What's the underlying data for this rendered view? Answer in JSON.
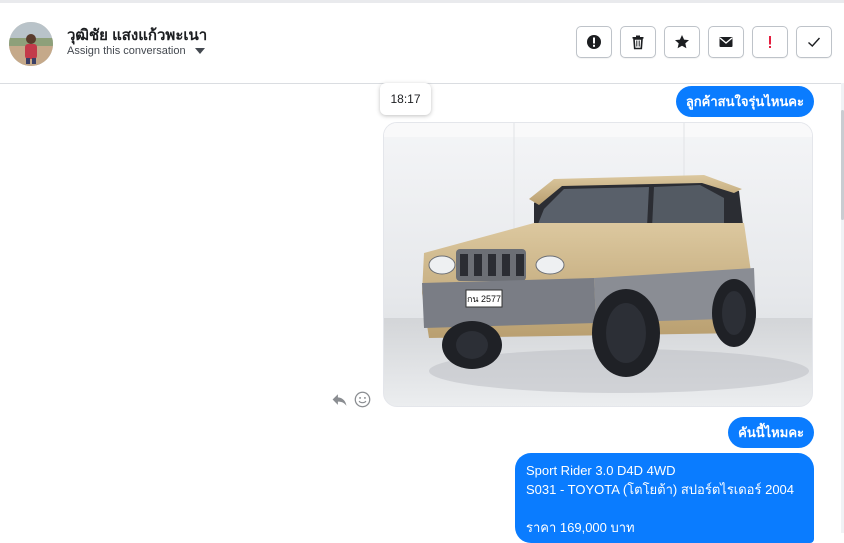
{
  "header": {
    "contact_name": "วุฒิชัย แสงแก้วพะเนา",
    "assign_label": "Assign this conversation",
    "actions": [
      {
        "name": "report-spam-button",
        "icon": "alert-circle-icon"
      },
      {
        "name": "delete-button",
        "icon": "trash-icon"
      },
      {
        "name": "star-button",
        "icon": "star-icon"
      },
      {
        "name": "mark-unread-button",
        "icon": "envelope-icon"
      },
      {
        "name": "flag-important-button",
        "icon": "exclamation-icon"
      },
      {
        "name": "mark-done-button",
        "icon": "check-icon"
      }
    ]
  },
  "messages": {
    "timestamp_tooltip": "18:17",
    "msg1": "ลูกค้าสนใจรุ่นไหนคะ",
    "msg2": "คันนี้ไหมคะ",
    "car_info": {
      "line1": "Sport Rider 3.0 D4D 4WD",
      "line2": "S031 - TOYOTA (โตโยต้า) สปอร์ตไรเดอร์ 2004",
      "line3": "ราคา 169,000 บาท"
    },
    "plate_text": "กน 2577"
  },
  "colors": {
    "accent": "#0a7cff",
    "danger": "#e41e3f",
    "car_body": "#cdb68a"
  }
}
